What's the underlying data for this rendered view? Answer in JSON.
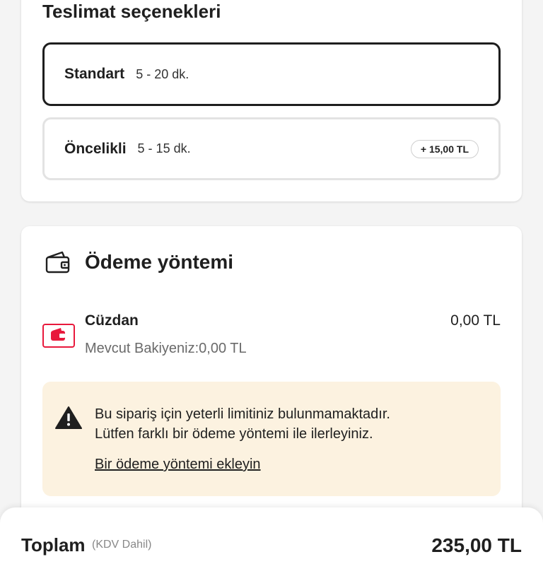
{
  "colors": {
    "selected_border": "#1e1e1e",
    "unselected_border": "#e3e3e3",
    "brand_red": "#e8193c",
    "warning_bg": "#fcf2e0",
    "muted_text": "#6a6a6a"
  },
  "delivery": {
    "title": "Teslimat seçenekleri",
    "options": [
      {
        "name": "Standart",
        "time": "5 - 20 dk.",
        "selected": true
      },
      {
        "name": "Öncelikli",
        "time": "5 - 15 dk.",
        "price": "+ 15,00 TL",
        "selected": false
      }
    ]
  },
  "payment": {
    "title": "Ödeme yöntemi",
    "title_icon": "wallet-icon",
    "wallet": {
      "icon": "wallet-logo-icon",
      "name": "Cüzdan",
      "balance": "Mevcut Bakiyeniz:0,00 TL",
      "amount": "0,00 TL"
    },
    "warning": {
      "icon": "warning-icon",
      "line1": "Bu sipariş için yeterli limitiniz bulunmamaktadır.",
      "line2": "Lütfen farklı bir ödeme yöntemi ile ilerleyiniz.",
      "link": "Bir ödeme yöntemi ekleyin"
    }
  },
  "footer": {
    "total_label": "Toplam",
    "total_note": "(KDV Dahil)",
    "total_value": "235,00 TL"
  }
}
